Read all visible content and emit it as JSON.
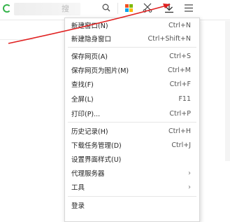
{
  "toolbar": {
    "address_hint": "搜",
    "icons": [
      "search-icon",
      "apps-grid-icon",
      "cut-icon",
      "download-icon",
      "menu-icon"
    ],
    "apps_colors": [
      "#f25022",
      "#7fba00",
      "#00a4ef",
      "#ffb900"
    ]
  },
  "menu": {
    "items": [
      {
        "label": "新建窗口(N)",
        "shortcut": "Ctrl+N"
      },
      {
        "label": "新建隐身窗口",
        "shortcut": "Ctrl+Shift+N"
      },
      {
        "label": "保存网页(A)",
        "shortcut": "Ctrl+S"
      },
      {
        "label": "保存网页为图片(M)",
        "shortcut": "Ctrl+M"
      },
      {
        "label": "查找(F)",
        "shortcut": "Ctrl+F"
      },
      {
        "label": "全屏(L)",
        "shortcut": "F11"
      },
      {
        "label": "打印(P)...",
        "shortcut": "Ctrl+P"
      },
      {
        "label": "历史记录(H)",
        "shortcut": "Ctrl+H"
      },
      {
        "label": "下载任务管理(D)",
        "shortcut": "Ctrl+J"
      },
      {
        "label": "设置界面样式(U)",
        "shortcut": ""
      },
      {
        "label": "代理服务器",
        "shortcut": "",
        "submenu": true
      },
      {
        "label": "工具",
        "shortcut": "",
        "submenu": true
      },
      {
        "label": "登录",
        "shortcut": ""
      }
    ],
    "submenu_arrow": "›"
  },
  "colors": {
    "annotation": "#e02020",
    "logo_green": "#34b34a"
  }
}
